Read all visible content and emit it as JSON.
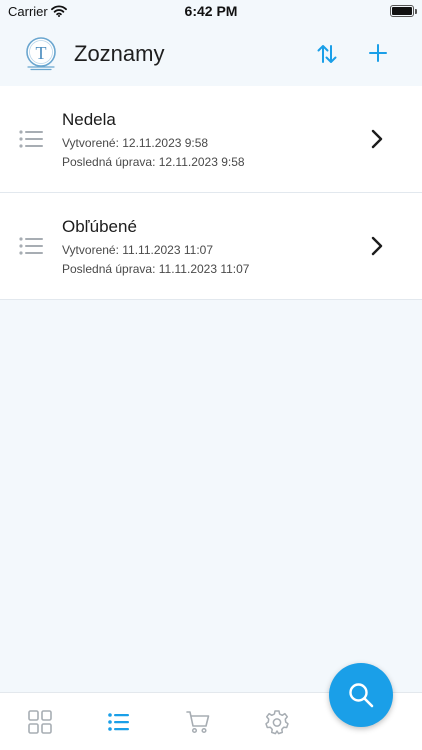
{
  "status_bar": {
    "carrier": "Carrier",
    "time": "6:42 PM",
    "wifi_icon": "wifi-icon",
    "battery_icon": "battery-icon"
  },
  "header": {
    "title": "Zoznamy",
    "logo_letter": "T",
    "sort_icon": "sort-arrows-icon",
    "add_icon": "plus-icon"
  },
  "lists": [
    {
      "name": "Nedela",
      "created": "Vytvorené: 12.11.2023 9:58",
      "modified": "Posledná úprava: 12.11.2023 9:58"
    },
    {
      "name": "Obľúbené",
      "created": "Vytvorené: 11.11.2023 11:07",
      "modified": "Posledná úprava: 11.11.2023 11:07"
    }
  ],
  "tab_bar": {
    "tabs": [
      {
        "icon": "grid-icon",
        "active": false
      },
      {
        "icon": "list-icon",
        "active": true
      },
      {
        "icon": "cart-icon",
        "active": false
      },
      {
        "icon": "gear-icon",
        "active": false
      }
    ]
  },
  "fab": {
    "icon": "search-icon"
  },
  "colors": {
    "accent": "#1a9fe8",
    "background": "#f3f8fc",
    "card": "#ffffff",
    "inactive_icon": "#a7adb3"
  }
}
